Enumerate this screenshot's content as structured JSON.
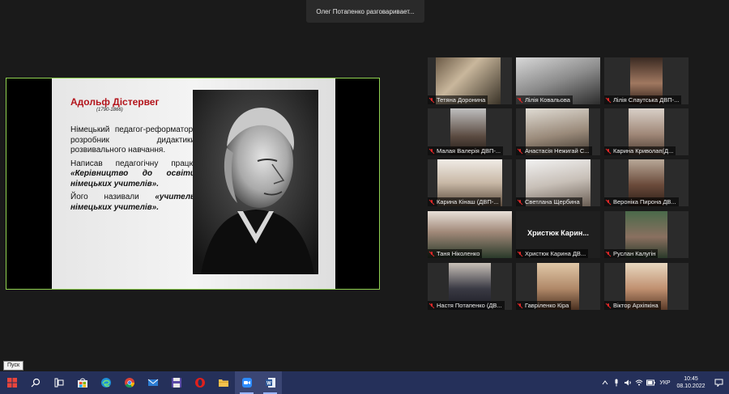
{
  "speaking_banner": "Олег Потапенко разговаривает...",
  "slide": {
    "title": "Адольф Дістервег",
    "years": "(1790-1866)",
    "para1": "Німецький педагог-реформатор, розробник дидактики розвивального навчання.",
    "para2_prefix": "Написав педагогічну працю ",
    "para2_em": "«Керівництво до освіти німецьких учителів».",
    "para3_prefix": "Його називали ",
    "para3_em": "«учитель німецьких учителів»."
  },
  "participants": [
    {
      "name": "Тетяна Доронина",
      "muted": true
    },
    {
      "name": "Лілія Ковальова",
      "muted": true
    },
    {
      "name": "Лілія Слаутська ДВП-...",
      "muted": true
    },
    {
      "name": "Малая Валерія ДВП-...",
      "muted": true
    },
    {
      "name": "Анастасія Нежигай С...",
      "muted": true
    },
    {
      "name": "Карина Криволап(Д...",
      "muted": true
    },
    {
      "name": "Карина Кінаш (ДВП-...",
      "muted": true
    },
    {
      "name": "Светлана Щербина",
      "muted": true
    },
    {
      "name": "Вероніка Пирона ДВ...",
      "muted": true
    },
    {
      "name": "Таня Ніколенко",
      "muted": true
    },
    {
      "name": "Христюк Карина ДВ...",
      "muted": true,
      "placeholder": "Христюк  Карин..."
    },
    {
      "name": "Руслан Калугін",
      "muted": true
    },
    {
      "name": "Настя Потапенко (ДВ...",
      "muted": true
    },
    {
      "name": "Гавріленко Кіра",
      "muted": true
    },
    {
      "name": "Віктор Архіпкіна",
      "muted": true
    }
  ],
  "taskbar": {
    "tooltip": "Пуск",
    "language": "УКР",
    "time": "10:45",
    "date": "08.10.2022",
    "icons": [
      "start-icon",
      "search-icon",
      "task-view-icon",
      "store-icon",
      "edge-icon",
      "chrome-icon",
      "mail-icon",
      "save-icon",
      "opera-icon",
      "file-explorer-icon",
      "zoom-icon",
      "word-icon"
    ]
  },
  "colors": {
    "accent_green": "#8fd14f",
    "muted_red": "#e02828",
    "slide_title": "#b3141b",
    "taskbar": "#25305a"
  }
}
